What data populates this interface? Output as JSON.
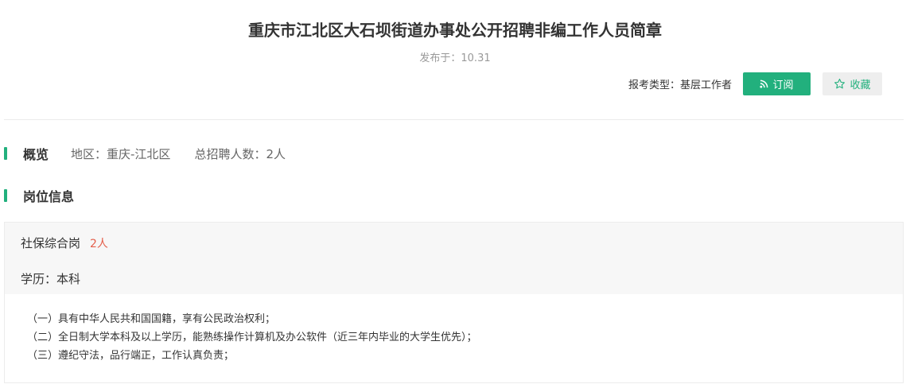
{
  "header": {
    "title": "重庆市江北区大石坝街道办事处公开招聘非编工作人员简章",
    "pub_label": "发布于：",
    "pub_date": "10.31"
  },
  "actions": {
    "exam_type": "报考类型：基层工作者",
    "subscribe_label": "订阅",
    "collect_label": "收藏",
    "accent_color": "#22b07d"
  },
  "overview": {
    "title": "概览",
    "region": "地区：重庆-江北区",
    "total": "总招聘人数：2人"
  },
  "positions": {
    "title": "岗位信息",
    "job": {
      "name": "社保综合岗",
      "count": "2人",
      "education": "学历：本科",
      "requirements": [
        "（一）具有中华人民共和国国籍，享有公民政治权利；",
        "（二）全日制大学本科及以上学历，能熟练操作计算机及办公软件（近三年内毕业的大学生优先）；",
        "（三）遵纪守法，品行端正，工作认真负责；"
      ]
    }
  }
}
